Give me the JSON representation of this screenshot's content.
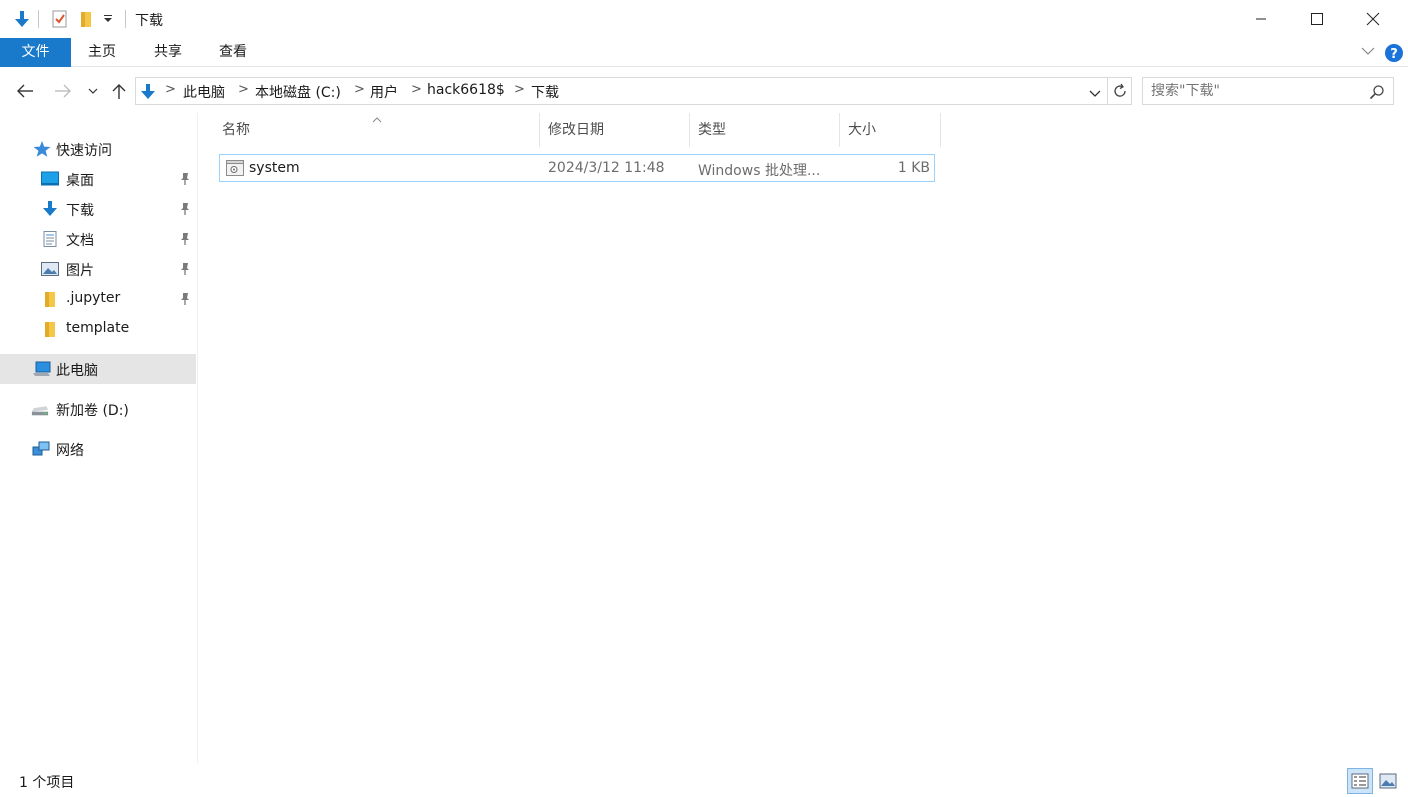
{
  "window": {
    "title": "下载",
    "quick_access_icons": [
      "download-arrow-icon",
      "properties-check-icon",
      "new-folder-icon",
      "customize-dropdown-icon"
    ],
    "controls": [
      "minimize",
      "maximize",
      "close"
    ]
  },
  "ribbon": {
    "tabs": [
      {
        "label": "文件",
        "active": true
      },
      {
        "label": "主页"
      },
      {
        "label": "共享"
      },
      {
        "label": "查看"
      }
    ]
  },
  "address": {
    "crumbs": [
      "此电脑",
      "本地磁盘 (C:)",
      "用户",
      "hack6618$",
      "下载"
    ],
    "search_placeholder": "搜索\"下载\""
  },
  "nav_pane": {
    "quick_access_label": "快速访问",
    "items": [
      {
        "label": "桌面",
        "icon": "desktop-icon",
        "pinned": true
      },
      {
        "label": "下载",
        "icon": "download-icon",
        "pinned": true
      },
      {
        "label": "文档",
        "icon": "documents-icon",
        "pinned": true
      },
      {
        "label": "图片",
        "icon": "pictures-icon",
        "pinned": true
      },
      {
        "label": ".jupyter",
        "icon": "folder-icon",
        "pinned": true
      },
      {
        "label": "template",
        "icon": "folder-icon",
        "pinned": false
      }
    ],
    "this_pc_label": "此电脑",
    "drive_label": "新加卷 (D:)",
    "network_label": "网络"
  },
  "columns": {
    "name": "名称",
    "date": "修改日期",
    "type": "类型",
    "size": "大小"
  },
  "files": [
    {
      "name": "system",
      "date": "2024/3/12 11:48",
      "type": "Windows 批处理...",
      "size": "1 KB"
    }
  ],
  "status": {
    "count_text": "1 个项目"
  },
  "colors": {
    "accent": "#1979ca",
    "selection_border": "#99d1ff",
    "selected_nav": "#e5e5e5",
    "help": "#1a73d9"
  }
}
